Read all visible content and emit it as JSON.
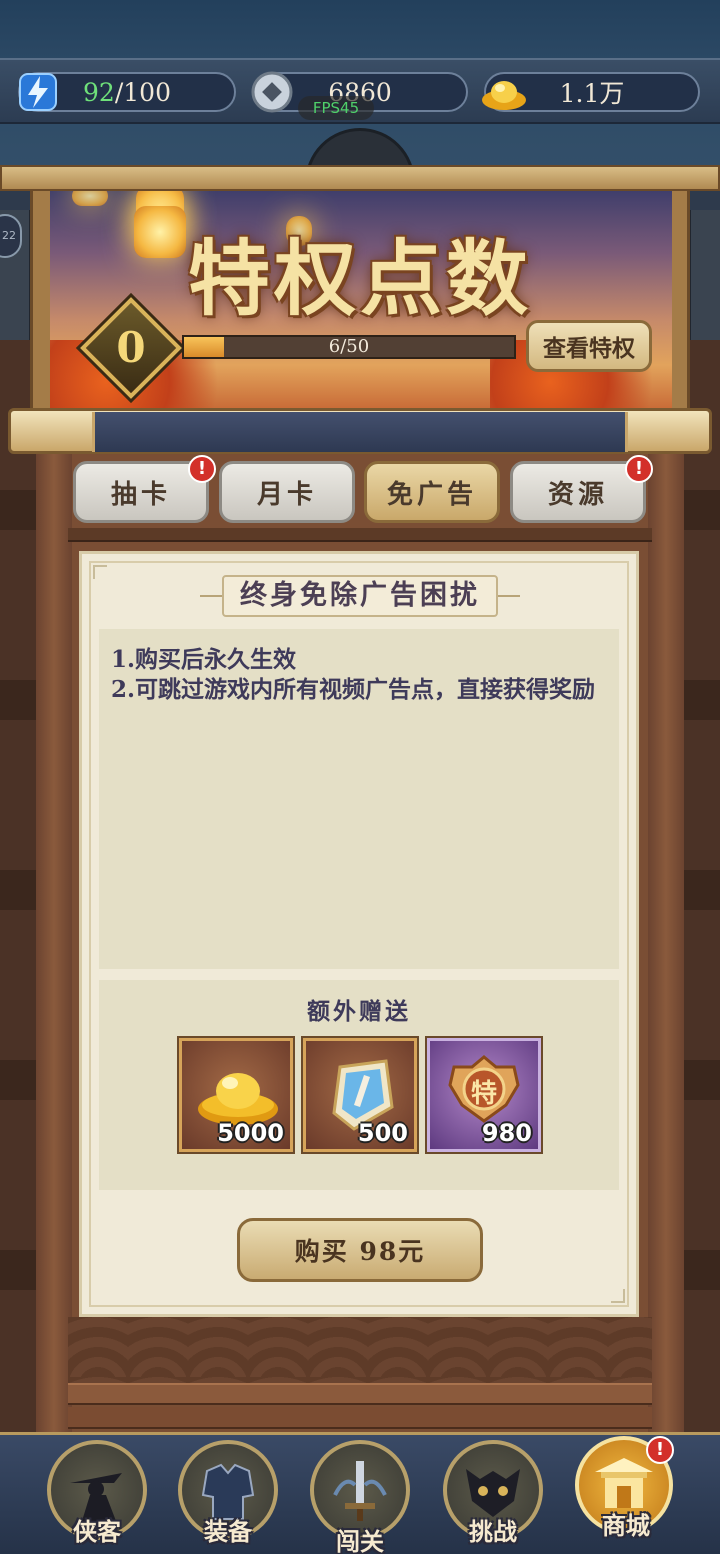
{
  "resources": {
    "stamina_current": "92",
    "stamina_max": "/100",
    "coins": "6860",
    "gold": "1.1万",
    "fps": "FPS45"
  },
  "side_badge": "22",
  "banner": {
    "title": "特权点数",
    "level": "0",
    "progress_text": "6/50",
    "progress_fraction": 0.12,
    "view_button": "查看特权"
  },
  "tabs": [
    {
      "label": "抽卡",
      "badge": "!"
    },
    {
      "label": "月卡",
      "badge": ""
    },
    {
      "label": "免广告",
      "badge": "",
      "active": true
    },
    {
      "label": "资源",
      "badge": "!"
    }
  ],
  "panel": {
    "section_title": "终身免除广告困扰",
    "description": [
      "1.购买后永久生效",
      "2.可跳过游戏内所有视频广告点，直接获得奖励"
    ],
    "gift_title": "额外赠送",
    "gifts": [
      {
        "icon": "gold-ingot-icon",
        "qty": "5000"
      },
      {
        "icon": "scroll-token-icon",
        "qty": "500"
      },
      {
        "icon": "privilege-medal-icon",
        "glyph": "特",
        "qty": "980"
      }
    ],
    "buy_button": "购买 98元"
  },
  "nav": [
    {
      "label": "侠客",
      "icon": "hero-icon"
    },
    {
      "label": "装备",
      "icon": "armor-icon"
    },
    {
      "label": "闯关",
      "icon": "sword-icon"
    },
    {
      "label": "挑战",
      "icon": "demon-mask-icon"
    },
    {
      "label": "商城",
      "icon": "shop-icon",
      "active": true,
      "badge": "!"
    }
  ],
  "colors": {
    "accent_gold": "#d9b45a",
    "badge_red": "#d3302a",
    "text_purple": "#3e3a5a",
    "stamina_green": "#6fe07a"
  }
}
